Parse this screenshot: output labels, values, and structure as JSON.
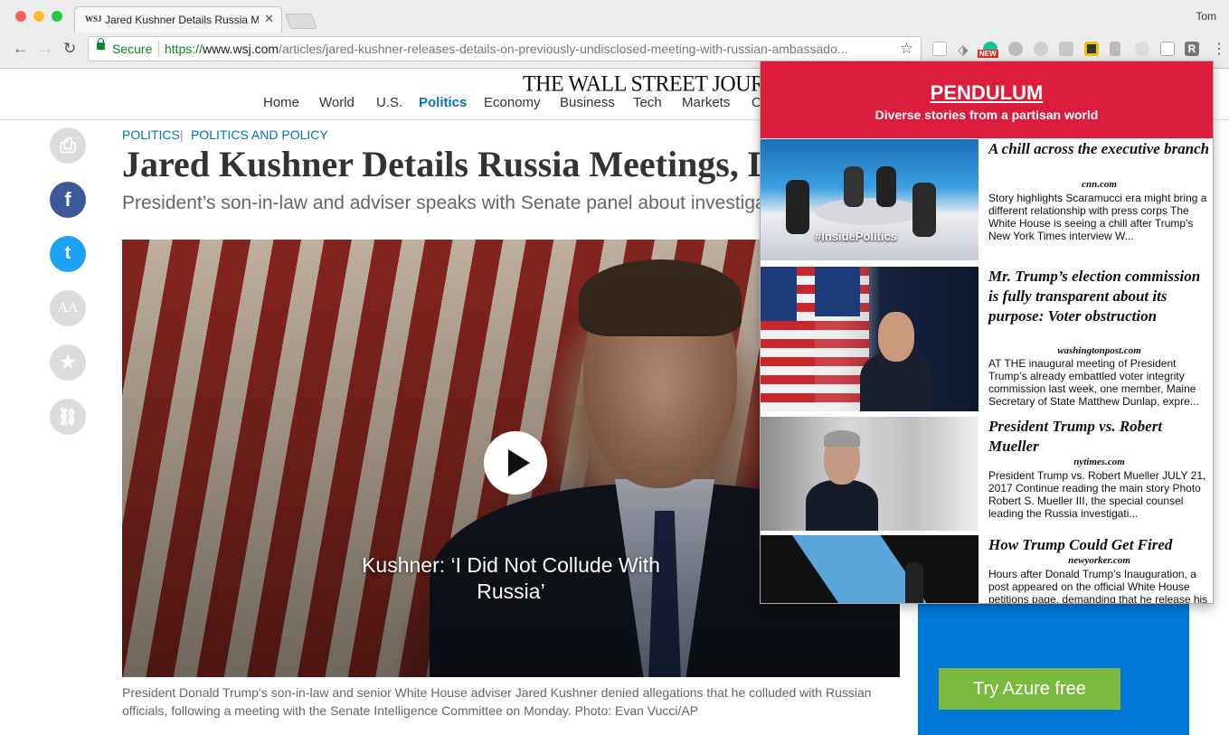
{
  "browser": {
    "tab_favicon": "WSJ",
    "tab_title": "Jared Kushner Details Russia Meetings",
    "user": "Tom",
    "secure_label": "Secure",
    "url_scheme": "https://",
    "url_host": "www.wsj.com",
    "url_path": "/articles/jared-kushner-releases-details-on-previously-undisclosed-meeting-with-russian-ambassado...",
    "extensions": [
      "reader-icon",
      "tag-icon",
      "grammarly-icon",
      "hand-icon",
      "swirl-icon",
      "download-icon",
      "qr-icon",
      "books-icon",
      "circle-icon",
      "monitor-icon",
      "r-icon"
    ],
    "ext_badge": "NEW"
  },
  "wsj": {
    "masthead": "THE WALL STREET JOURNAL.",
    "nav": [
      "Home",
      "World",
      "U.S.",
      "Politics",
      "Economy",
      "Business",
      "Tech",
      "Markets",
      "O"
    ],
    "active_nav": "Politics",
    "crumbs": [
      "POLITICS",
      "POLITICS AND POLICY"
    ],
    "crumb_sep": "|",
    "headline": "Jared Kushner Details Russia Meetings, Denies Collusion",
    "dek": "President’s son-in-law and adviser speaks with Senate panel about investigation",
    "share": [
      "print-icon",
      "facebook-icon",
      "twitter-icon",
      "text-size-icon",
      "save-icon",
      "link-icon"
    ],
    "share_glyphs": {
      "print": "⎙",
      "facebook": "f",
      "twitter": "t",
      "text": "AA",
      "save": "★",
      "link": "⛓"
    },
    "video_title": "Kushner: ‘I Did Not Collude With Russia’",
    "caption": "President Donald Trump’s son-in-law and senior White House adviser Jared Kushner denied allegations that he colluded with Russian officials, following a meeting with the Senate Intelligence Committee on Monday. Photo: Evan Vucci/AP"
  },
  "ad": {
    "button": "Try Azure free"
  },
  "pendulum": {
    "title": "PENDULUM",
    "subtitle": "Diverse stories from a partisan world",
    "stories": [
      {
        "title": "A chill across the executive branch",
        "source": "cnn.com",
        "text": "Story highlights Scaramucci era might bring a different relationship with press corps The White House is seeing a chill after Trump's New York Times interview W...",
        "thumb_label": "#InsidePolitics"
      },
      {
        "title": "Mr. Trump’s election commission is fully transparent about its purpose: Voter obstruction",
        "source": "washingtonpost.com",
        "text": "AT THE inaugural meeting of President Trump’s already embattled voter integrity commission last week, one member, Maine Secretary of State Matthew Dunlap, expre..."
      },
      {
        "title": "President Trump vs. Robert Mueller",
        "source": "nytimes.com",
        "text": "President Trump vs. Robert Mueller JULY 21, 2017 Continue reading the main story Photo Robert S. Mueller III, the special counsel leading the Russia investigati..."
      },
      {
        "title": "How Trump Could Get Fired",
        "source": "newyorker.com",
        "text": "Hours after Donald Trump’s Inauguration, a post appeared on the official White House petitions page, demanding that he release his"
      }
    ]
  }
}
